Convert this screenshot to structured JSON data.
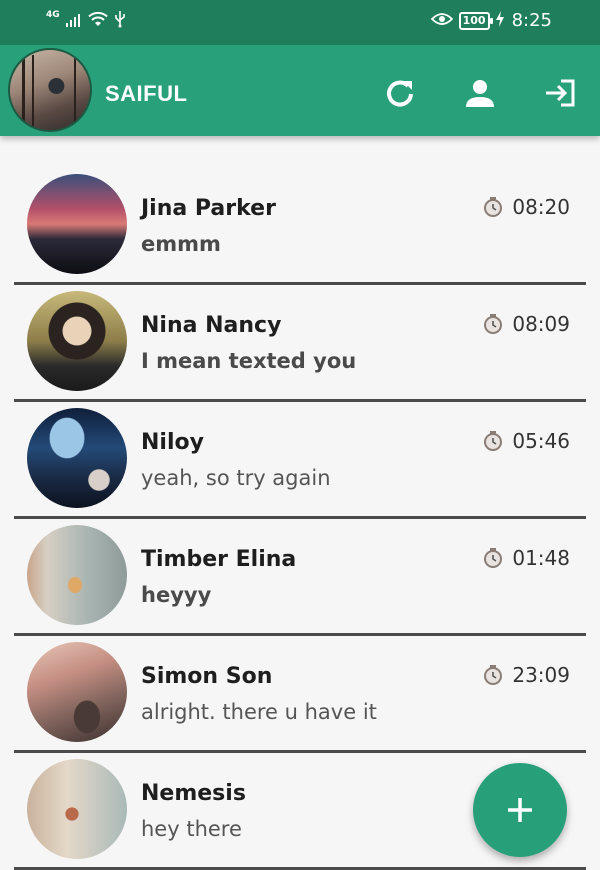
{
  "status_bar": {
    "network": "4G",
    "battery": "100",
    "time": "8:25"
  },
  "app_bar": {
    "user_name": "SAIFUL",
    "icons": [
      "refresh-icon",
      "person-icon",
      "logout-icon"
    ]
  },
  "colors": {
    "primary": "#28a07a",
    "primary_dark": "#1f7f5c",
    "background": "#f6f6f6",
    "divider": "#4a4a4a"
  },
  "chats": [
    {
      "name": "Jina Parker",
      "message": "emmm",
      "time": "08:20",
      "unread": true
    },
    {
      "name": "Nina Nancy",
      "message": "I mean texted you",
      "time": "08:09",
      "unread": true
    },
    {
      "name": "Niloy",
      "message": "yeah, so try again",
      "time": "05:46",
      "unread": false
    },
    {
      "name": "Timber Elina",
      "message": "heyyy",
      "time": "01:48",
      "unread": true
    },
    {
      "name": "Simon Son",
      "message": "alright. there u have it",
      "time": "23:09",
      "unread": false
    },
    {
      "name": "Nemesis",
      "message": "hey there",
      "time": "",
      "unread": false
    }
  ],
  "fab": {
    "icon": "plus-icon"
  }
}
